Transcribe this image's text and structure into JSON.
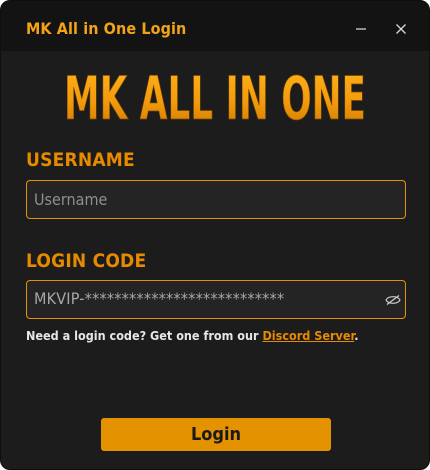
{
  "window": {
    "title": "MK All in One Login"
  },
  "brand": {
    "logo_text": "MK ALL IN ONE"
  },
  "form": {
    "username": {
      "label": "USERNAME",
      "placeholder": "Username",
      "value": ""
    },
    "login_code": {
      "label": "LOGIN CODE",
      "value": "MKVIP-***************************",
      "visibility_icon": "eye-hidden-icon"
    }
  },
  "help": {
    "prefix": "Need a login code? Get one from our ",
    "link_text": "Discord Server",
    "suffix": "."
  },
  "actions": {
    "login_label": "Login"
  },
  "colors": {
    "accent": "#e59200",
    "background": "#1c1c1c",
    "titlebar": "#131313"
  }
}
